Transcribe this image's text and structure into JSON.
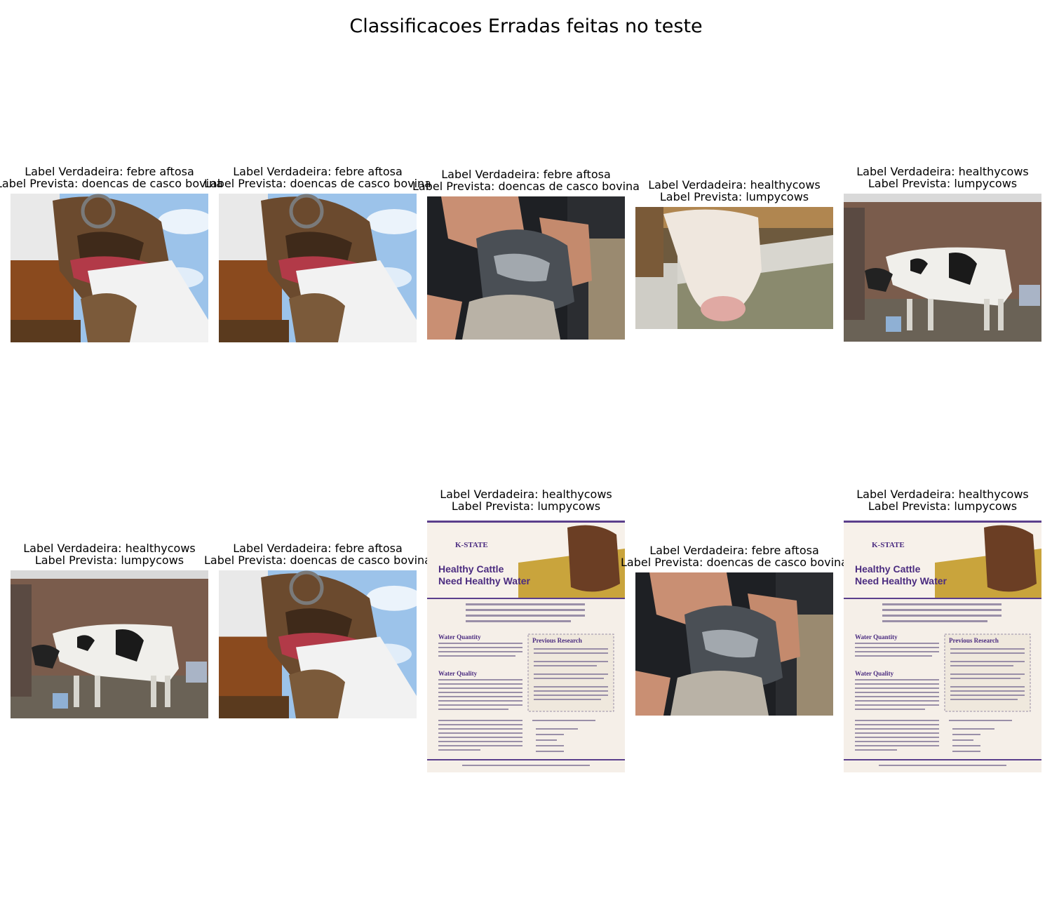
{
  "title": "Classificacoes Erradas feitas no teste",
  "samples": [
    {
      "true_label": "Label Verdadeira: febre aftosa",
      "pred_label": "Label Prevista: doencas de casco bovina",
      "image": "cow-mouth-photo"
    },
    {
      "true_label": "Label Verdadeira: febre aftosa",
      "pred_label": "Label Prevista: doencas de casco bovina",
      "image": "cow-mouth-photo"
    },
    {
      "true_label": "Label Verdadeira: febre aftosa",
      "pred_label": "Label Prevista: doencas de casco bovina",
      "image": "hoof-in-hands-photo"
    },
    {
      "true_label": "Label Verdadeira: healthycows",
      "pred_label": "Label Prevista: lumpycows",
      "image": "cow-drinking-photo"
    },
    {
      "true_label": "Label Verdadeira: healthycows",
      "pred_label": "Label Prevista: lumpycows",
      "image": "cow-in-shed-photo"
    },
    {
      "true_label": "Label Verdadeira: healthycows",
      "pred_label": "Label Prevista: lumpycows",
      "image": "cow-in-shed-photo"
    },
    {
      "true_label": "Label Verdadeira: febre aftosa",
      "pred_label": "Label Prevista: doencas de casco bovina",
      "image": "cow-mouth-photo"
    },
    {
      "true_label": "Label Verdadeira: healthycows",
      "pred_label": "Label Prevista: lumpycows",
      "image": "kstate-flyer",
      "flyer": {
        "logo": "K-STATE",
        "heading1": "Healthy Cattle",
        "heading2": "Need Healthy Water",
        "sec1": "Water Quantity",
        "sec2": "Water Quality",
        "sec3": "Previous Research"
      }
    },
    {
      "true_label": "Label Verdadeira: febre aftosa",
      "pred_label": "Label Prevista: doencas de casco bovina",
      "image": "hoof-in-hands-photo"
    },
    {
      "true_label": "Label Verdadeira: healthycows",
      "pred_label": "Label Prevista: lumpycows",
      "image": "kstate-flyer",
      "flyer": {
        "logo": "K-STATE",
        "heading1": "Healthy Cattle",
        "heading2": "Need Healthy Water",
        "sec1": "Water Quantity",
        "sec2": "Water Quality",
        "sec3": "Previous Research"
      }
    }
  ]
}
